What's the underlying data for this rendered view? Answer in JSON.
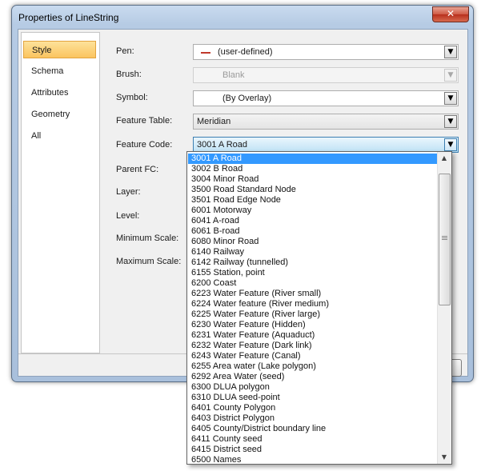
{
  "window": {
    "title": "Properties of LineString",
    "close_glyph": "✕"
  },
  "sidebar": {
    "items": [
      {
        "label": "Style"
      },
      {
        "label": "Schema"
      },
      {
        "label": "Attributes"
      },
      {
        "label": "Geometry"
      },
      {
        "label": "All"
      }
    ],
    "active": "Style"
  },
  "form": {
    "pen": {
      "label": "Pen:",
      "value": "(user-defined)",
      "color": "#c0392b"
    },
    "brush": {
      "label": "Brush:",
      "value": "Blank"
    },
    "symbol": {
      "label": "Symbol:",
      "value": "(By Overlay)"
    },
    "feature_table": {
      "label": "Feature Table:",
      "value": "Meridian"
    },
    "feature_code": {
      "label": "Feature Code:",
      "value": "3001 A Road"
    },
    "parent_fc": {
      "label": "Parent FC:"
    },
    "layer": {
      "label": "Layer:"
    },
    "level": {
      "label": "Level:"
    },
    "minimum_scale": {
      "label": "Minimum Scale:"
    },
    "maximum_scale": {
      "label": "Maximum Scale:"
    }
  },
  "dropdown": {
    "selected": "3001 A Road",
    "options": [
      "3001 A Road",
      "3002 B Road",
      "3004 Minor Road",
      "3500 Road Standard Node",
      "3501 Road Edge Node",
      "6001 Motorway",
      "6041 A-road",
      "6061 B-road",
      "6080 Minor Road",
      "6140 Railway",
      "6142 Railway (tunnelled)",
      "6155 Station, point",
      "6200 Coast",
      "6223 Water Feature (River small)",
      "6224 Water feature (River medium)",
      "6225 Water Feature (River large)",
      "6230 Water Feature (Hidden)",
      "6231 Water Feature (Aquaduct)",
      "6232 Water Feature (Dark link)",
      "6243 Water Feature (Canal)",
      "6255 Area water (Lake polygon)",
      "6292 Area Water (seed)",
      "6300 DLUA polygon",
      "6310 DLUA seed-point",
      "6401 County Polygon",
      "6403 District Polygon",
      "6405 County/District boundary line",
      "6411 County seed",
      "6415 District seed",
      "6500 Names"
    ]
  },
  "icons": {
    "dropdown_arrow": "chevron-down-icon",
    "scroll_up": "scroll-up-icon",
    "scroll_down": "scroll-down-icon"
  }
}
